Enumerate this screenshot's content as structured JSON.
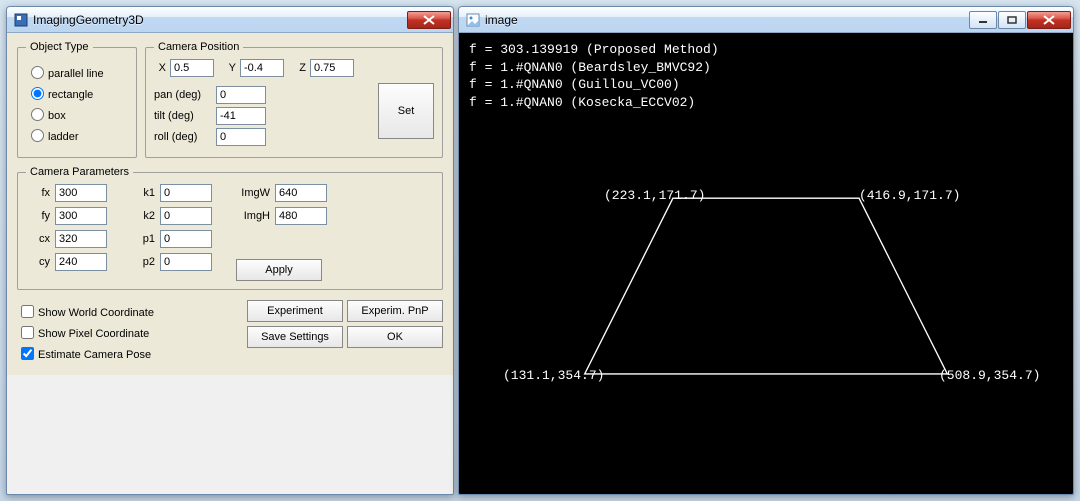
{
  "windowL": {
    "title": "ImagingGeometry3D",
    "objectType": {
      "legend": "Object Type",
      "opts": {
        "parallel": "parallel line",
        "rectangle": "rectangle",
        "box": "box",
        "ladder": "ladder"
      },
      "selected": "rectangle"
    },
    "cameraPos": {
      "legend": "Camera Position",
      "X": "0.5",
      "Y": "-0.4",
      "Z": "0.75",
      "Xlbl": "X",
      "Ylbl": "Y",
      "Zlbl": "Z",
      "pan_lbl": "pan (deg)",
      "tilt_lbl": "tilt (deg)",
      "roll_lbl": "roll (deg)",
      "pan": "0",
      "tilt": "-41",
      "roll": "0",
      "set_btn": "Set"
    },
    "cameraParams": {
      "legend": "Camera Parameters",
      "fx_lbl": "fx",
      "fx": "300",
      "fy_lbl": "fy",
      "fy": "300",
      "cx_lbl": "cx",
      "cx": "320",
      "cy_lbl": "cy",
      "cy": "240",
      "k1_lbl": "k1",
      "k1": "0",
      "k2_lbl": "k2",
      "k2": "0",
      "p1_lbl": "p1",
      "p1": "0",
      "p2_lbl": "p2",
      "p2": "0",
      "imgw_lbl": "ImgW",
      "imgw": "640",
      "imgh_lbl": "ImgH",
      "imgh": "480",
      "apply_btn": "Apply"
    },
    "checks": {
      "worldcoord": "Show World Coordinate",
      "pixcoord": "Show Pixel Coordinate",
      "estpose": "Estimate Camera Pose"
    },
    "buttons": {
      "experiment": "Experiment",
      "experimpnp": "Experim. PnP",
      "savesettings": "Save Settings",
      "ok": "OK"
    }
  },
  "windowR": {
    "title": "image",
    "lines": [
      "f = 303.139919 (Proposed Method)",
      "f = 1.#QNAN0 (Beardsley_BMVC92)",
      "f = 1.#QNAN0 (Guillou_VC00)",
      "f = 1.#QNAN0 (Kosecka_ECCV02)"
    ],
    "corners": {
      "tl": "(223.1,171.7)",
      "tr": "(416.9,171.7)",
      "bl": "(131.1,354.7)",
      "br": "(508.9,354.7)"
    }
  }
}
